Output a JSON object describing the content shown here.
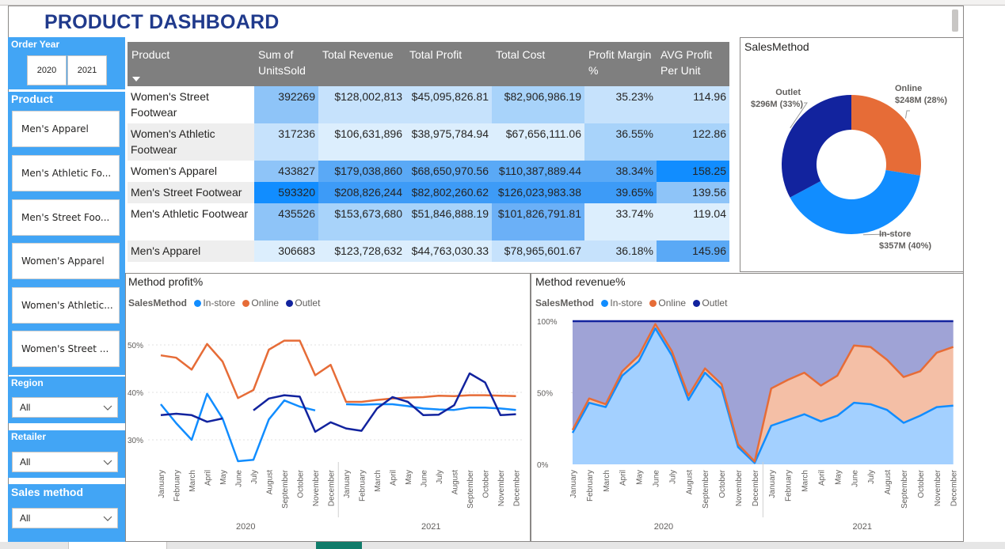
{
  "title": "PRODUCT DASHBOARD",
  "order_year": {
    "label": "Order Year",
    "options": [
      "2020",
      "2021"
    ]
  },
  "product_slicer": {
    "label": "Product",
    "items": [
      "Men's Apparel",
      "Men's Athletic Fo...",
      "Men's Street Foo...",
      "Women's Apparel",
      "Women's Athletic...",
      "Women's Street ..."
    ]
  },
  "region": {
    "label": "Region",
    "value": "All"
  },
  "retailer": {
    "label": "Retailer",
    "value": "All"
  },
  "sales_method": {
    "label": "Sales method",
    "value": "All"
  },
  "table": {
    "columns": [
      "Product",
      "Sum of UnitsSold",
      "Total Revenue",
      "Total Profit",
      "Total Cost",
      "Profit Margin %",
      "AVG Profit Per Unit"
    ],
    "rows": [
      [
        "Women's Street Footwear",
        "392269",
        "$128,002,813",
        "$45,095,826.81",
        "$82,906,986.19",
        "35.23%",
        "114.96"
      ],
      [
        "Women's Athletic Footwear",
        "317236",
        "$106,631,896",
        "$38,975,784.94",
        "$67,656,111.06",
        "36.55%",
        "122.86"
      ],
      [
        "Women's Apparel",
        "433827",
        "$179,038,860",
        "$68,650,970.56",
        "$110,387,889.44",
        "38.34%",
        "158.25"
      ],
      [
        "Men's Street Footwear",
        "593320",
        "$208,826,244",
        "$82,802,260.62",
        "$126,023,983.38",
        "39.65%",
        "139.56"
      ],
      [
        "Men's Athletic Footwear",
        "435526",
        "$153,673,680",
        "$51,846,888.19",
        "$101,826,791.81",
        "33.74%",
        "119.04"
      ],
      [
        "Men's Apparel",
        "306683",
        "$123,728,632",
        "$44,763,030.33",
        "$78,965,601.67",
        "36.18%",
        "145.96"
      ]
    ]
  },
  "colors": {
    "instore": "#118dff",
    "online": "#e66c37",
    "outlet": "#12239e",
    "accent": "#42a5f5",
    "title": "#203a8c"
  },
  "chart_data": [
    {
      "type": "pie",
      "title": "SalesMethod",
      "slices": [
        {
          "label": "Online",
          "value_label": "$248M (28%)",
          "value": 248
        },
        {
          "label": "In-store",
          "value_label": "$357M (40%)",
          "value": 357
        },
        {
          "label": "Outlet",
          "value_label": "$296M (33%)",
          "value": 296
        }
      ]
    },
    {
      "type": "line",
      "title": "Method profit%",
      "legend_title": "SalesMethod",
      "years": [
        "2020",
        "2021"
      ],
      "x": [
        "January",
        "February",
        "March",
        "April",
        "May",
        "June",
        "July",
        "August",
        "September",
        "October",
        "November",
        "December",
        "January",
        "February",
        "March",
        "April",
        "May",
        "June",
        "July",
        "August",
        "September",
        "October",
        "November",
        "December"
      ],
      "y_ticks": [
        "50%",
        "40%",
        "30%"
      ],
      "ylim": [
        25,
        55
      ],
      "series": [
        {
          "name": "In-store",
          "values": [
            37.5,
            33.5,
            30,
            39.7,
            34.5,
            25.5,
            25.8,
            34.3,
            38.3,
            37,
            36.2,
            null,
            37.5,
            37.4,
            37.5,
            37.5,
            37.1,
            36.6,
            36.4,
            36.3,
            36.8,
            36.8,
            36.6,
            36.3
          ]
        },
        {
          "name": "Online",
          "values": [
            47.8,
            47.3,
            44.8,
            50.2,
            46.5,
            38.8,
            40.5,
            49,
            50.9,
            50.9,
            43.6,
            45.8,
            38,
            38,
            38.4,
            38.7,
            38.9,
            39,
            39.3,
            39.2,
            39.4,
            39.4,
            39.3,
            39.2
          ]
        },
        {
          "name": "Outlet",
          "values": [
            35.2,
            35.5,
            35.2,
            33.8,
            34.5,
            null,
            36.2,
            38.7,
            39.4,
            39.1,
            31.7,
            33.7,
            32.4,
            31.9,
            36.6,
            39,
            38,
            35.2,
            35.3,
            37.3,
            44,
            42.1,
            35.2,
            35.4
          ]
        }
      ]
    },
    {
      "type": "area",
      "title": "Method revenue%",
      "legend_title": "SalesMethod",
      "years": [
        "2020",
        "2021"
      ],
      "x": [
        "January",
        "February",
        "March",
        "April",
        "May",
        "June",
        "July",
        "August",
        "September",
        "October",
        "November",
        "December",
        "January",
        "February",
        "March",
        "April",
        "May",
        "June",
        "July",
        "August",
        "September",
        "October",
        "November",
        "December"
      ],
      "y_ticks": [
        "100%",
        "50%",
        "0%"
      ],
      "ylim": [
        0,
        100
      ],
      "stacked": true,
      "series": [
        {
          "name": "In-store",
          "values": [
            22,
            43,
            40,
            62,
            72,
            95,
            76,
            45,
            64,
            53,
            12,
            1,
            27,
            31,
            35,
            30,
            34,
            43,
            42,
            38,
            29,
            34,
            40,
            41
          ]
        },
        {
          "name": "Online",
          "values": [
            2,
            3,
            2,
            3,
            4,
            3,
            3,
            3,
            3,
            3,
            2,
            1,
            26,
            28,
            29,
            25,
            28,
            40,
            40,
            35,
            32,
            31,
            38,
            41
          ]
        },
        {
          "name": "Outlet",
          "values": [
            76,
            54,
            58,
            35,
            24,
            2,
            21,
            52,
            33,
            44,
            86,
            98,
            47,
            41,
            36,
            45,
            38,
            17,
            18,
            27,
            39,
            35,
            22,
            18
          ]
        }
      ]
    }
  ]
}
